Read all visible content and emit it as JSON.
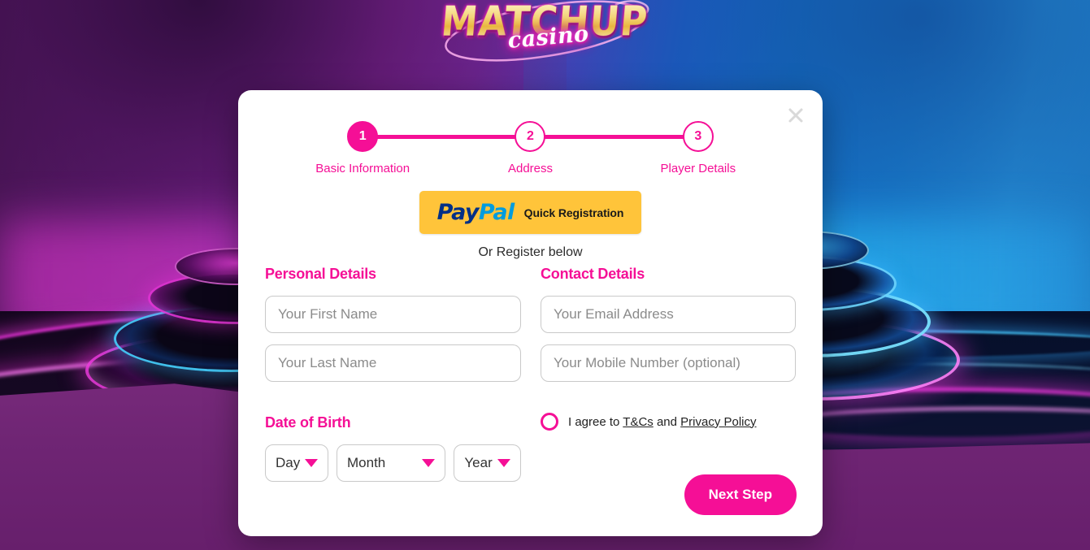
{
  "brand": {
    "logo_main": "MATCHUP",
    "logo_sub": "casino",
    "accent_color": "#F50F96",
    "paypal_gold": "#FFC43A",
    "paypal_navy": "#003087",
    "paypal_blue": "#009CDE"
  },
  "modal": {
    "close_icon": "close-icon",
    "stepper": {
      "steps": [
        {
          "number": "1",
          "label": "Basic Information",
          "state": "active"
        },
        {
          "number": "2",
          "label": "Address",
          "state": "idle"
        },
        {
          "number": "3",
          "label": "Player Details",
          "state": "idle"
        }
      ]
    },
    "paypal": {
      "logo_pay": "Pay",
      "logo_pal": "Pal",
      "button_text": "Quick Registration",
      "divider_text": "Or Register below"
    },
    "personal": {
      "heading": "Personal Details",
      "first_name": {
        "value": "",
        "placeholder": "Your First Name"
      },
      "last_name": {
        "value": "",
        "placeholder": "Your Last Name"
      }
    },
    "dob": {
      "heading": "Date of Birth",
      "day": {
        "selected": "Day"
      },
      "month": {
        "selected": "Month"
      },
      "year": {
        "selected": "Year"
      }
    },
    "contact": {
      "heading": "Contact Details",
      "email": {
        "value": "",
        "placeholder": "Your Email Address"
      },
      "mobile": {
        "value": "",
        "placeholder": "Your Mobile Number (optional)"
      }
    },
    "terms": {
      "checked": false,
      "prefix": "I agree to ",
      "link_tcs": "T&Cs",
      "middle": " and ",
      "link_privacy": "Privacy Policy"
    },
    "submit_label": "Next Step"
  }
}
